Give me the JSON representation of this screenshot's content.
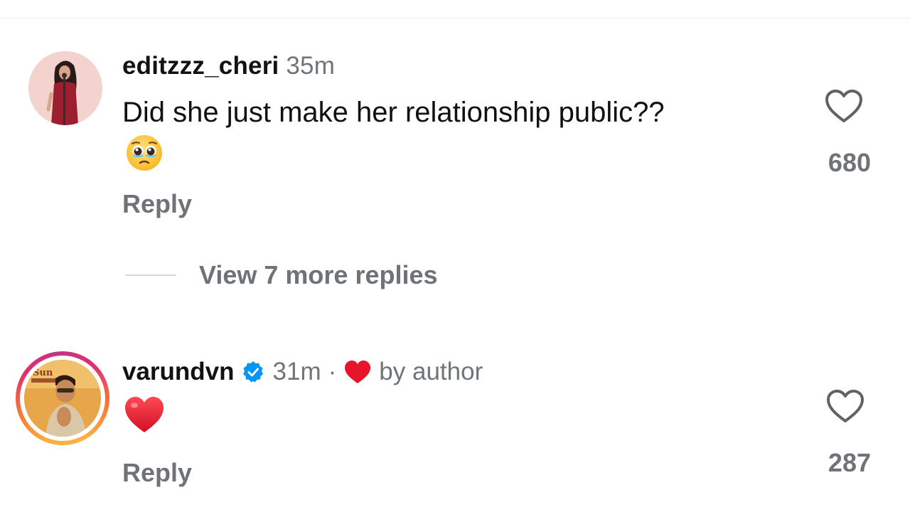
{
  "comments": [
    {
      "username": "editzzz_cheri",
      "time": "35m",
      "text": "Did she just make her relationship public??",
      "emoji": "pleading-face",
      "reply_label": "Reply",
      "likes": "680",
      "avatar": "avatar-singer-illustration"
    },
    {
      "username": "varundvn",
      "verified": true,
      "time": "31m",
      "separator": "·",
      "author_badge": "by author",
      "emoji": "red-heart",
      "reply_label": "Reply",
      "likes": "287",
      "avatar": "avatar-story-ring"
    }
  ],
  "view_replies": {
    "label": "View 7 more replies"
  },
  "colors": {
    "accent_red": "#e8142a",
    "verified_blue": "#0095f6",
    "muted_text": "#6f7378"
  }
}
